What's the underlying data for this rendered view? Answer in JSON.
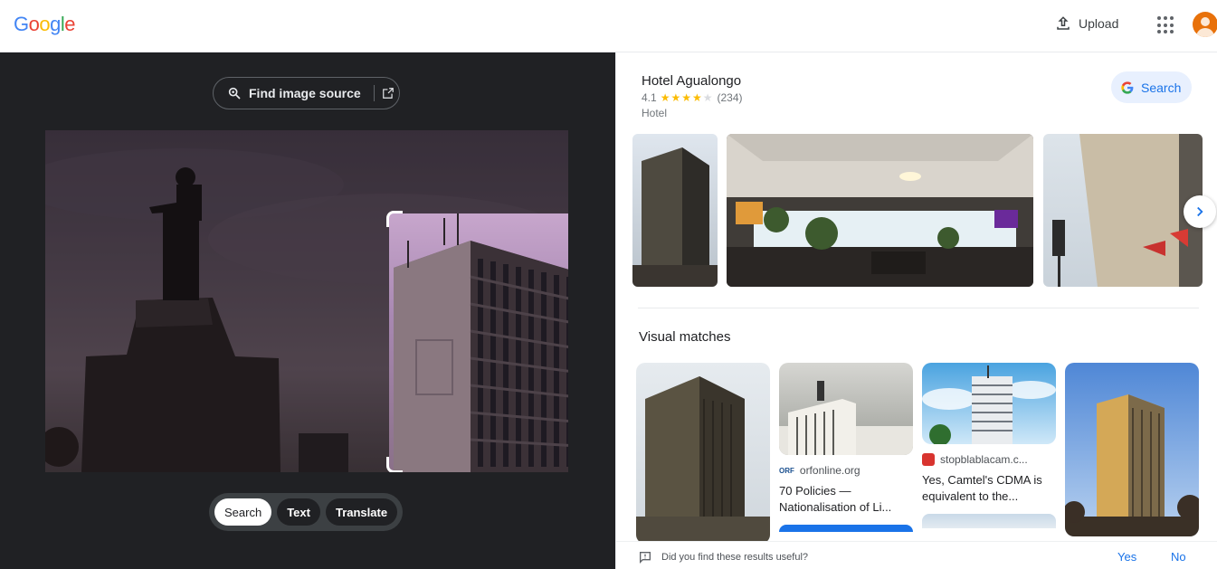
{
  "header": {
    "logo": [
      "G",
      "o",
      "o",
      "g",
      "l",
      "e"
    ],
    "logo_colors": [
      "#4285f4",
      "#ea4335",
      "#fbbc05",
      "#4285f4",
      "#34a853",
      "#ea4335"
    ],
    "upload_label": "Upload",
    "upload_icon": "upload-icon",
    "apps_icon": "apps-grid-icon",
    "avatar_icon": "account-avatar"
  },
  "lens": {
    "find_source_label": "Find image source",
    "modes": [
      {
        "label": "Search",
        "active": true
      },
      {
        "label": "Text",
        "active": false
      },
      {
        "label": "Translate",
        "active": false
      }
    ]
  },
  "knowledge_panel": {
    "title": "Hotel Agualongo",
    "rating": "4.1",
    "stars": 4,
    "reviews": "(234)",
    "type": "Hotel",
    "search_label": "Search"
  },
  "visual_matches": {
    "title": "Visual matches",
    "cards": [
      {
        "site": "",
        "desc": ""
      },
      {
        "site": "orfonline.org",
        "desc": "70 Policies — Nationalisation of Li...",
        "favicon": "ORF"
      },
      {
        "site": "stopblablacam.c...",
        "desc": "Yes, Camtel's CDMA is equivalent to the...",
        "favicon": "cam"
      },
      {
        "site": "",
        "desc": ""
      }
    ]
  },
  "feedback": {
    "question": "Did you find these results useful?",
    "yes": "Yes",
    "no": "No"
  },
  "colors": {
    "accent": "#1a73e8",
    "dark_bg": "#202124",
    "star": "#fbbc04"
  }
}
